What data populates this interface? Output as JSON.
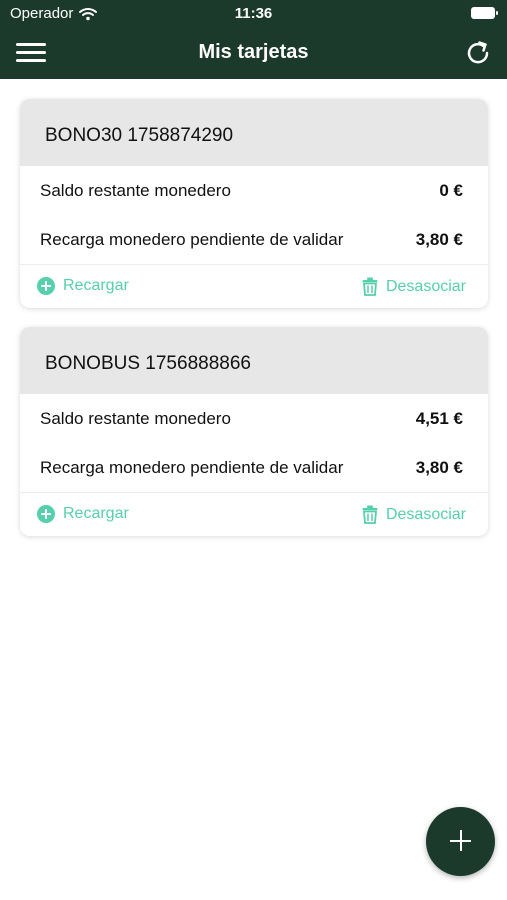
{
  "status_bar": {
    "carrier": "Operador",
    "time": "11:36"
  },
  "nav": {
    "title": "Mis tarjetas"
  },
  "colors": {
    "header": "#1c3a2b",
    "accent": "#58cfac",
    "card_header_bg": "#e7e7e7"
  },
  "cards": [
    {
      "title": "BONO30 1758874290",
      "rows": [
        {
          "label": "Saldo restante monedero",
          "value": "0 €"
        },
        {
          "label": "Recarga monedero pendiente de validar",
          "value": "3,80 €"
        }
      ],
      "actions": {
        "recharge": "Recargar",
        "unlink": "Desasociar"
      }
    },
    {
      "title": "BONOBUS 1756888866",
      "rows": [
        {
          "label": "Saldo restante monedero",
          "value": "4,51 €"
        },
        {
          "label": "Recarga monedero pendiente de validar",
          "value": "3,80 €"
        }
      ],
      "actions": {
        "recharge": "Recargar",
        "unlink": "Desasociar"
      }
    }
  ],
  "icons": {
    "menu": "hamburger-icon",
    "refresh": "refresh-icon",
    "recharge": "plus-circle-icon",
    "unlink": "trash-icon",
    "add": "plus-icon"
  }
}
